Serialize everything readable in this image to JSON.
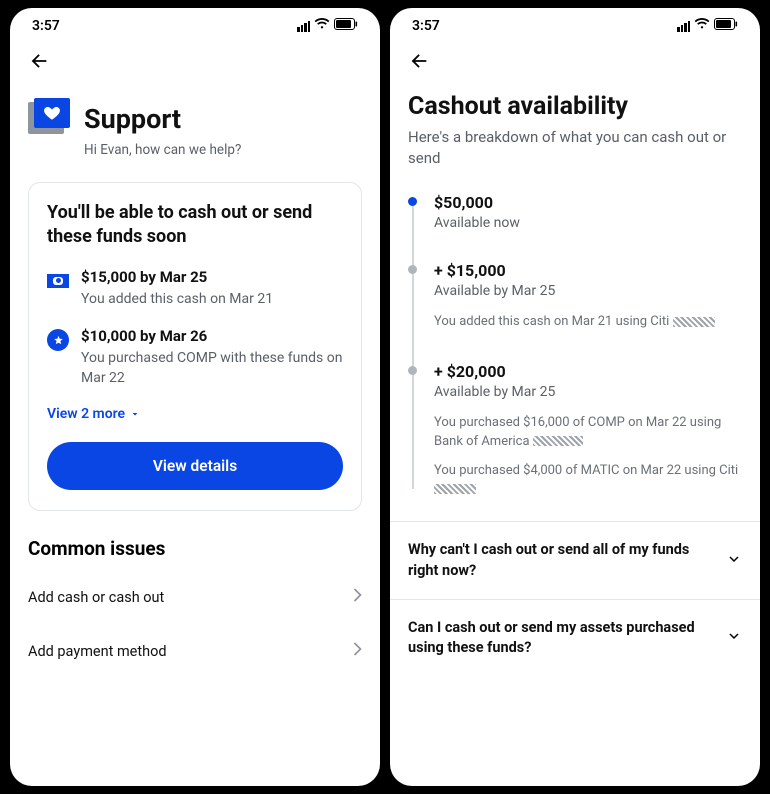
{
  "statusBar": {
    "time": "3:57"
  },
  "screen1": {
    "header": {
      "title": "Support",
      "subtitle": "Hi Evan, how can we help?"
    },
    "card": {
      "title": "You'll be able to cash out or send these funds soon",
      "items": [
        {
          "icon": "cash-icon",
          "amount": "$15,000 by Mar 25",
          "desc": "You added this cash on Mar 21"
        },
        {
          "icon": "star-icon",
          "amount": "$10,000 by Mar 26",
          "desc": "You purchased COMP with these funds on Mar 22"
        }
      ],
      "viewMore": "View 2 more",
      "button": "View details"
    },
    "commonIssues": {
      "title": "Common issues",
      "items": [
        {
          "label": "Add cash or cash out"
        },
        {
          "label": "Add payment method"
        }
      ]
    }
  },
  "screen2": {
    "title": "Cashout availability",
    "subtitle": "Here's a breakdown of what you can cash out or send",
    "timeline": [
      {
        "dot": "blue",
        "amount": "$50,000",
        "avail": "Available now",
        "details": []
      },
      {
        "dot": "gray",
        "amount": "+ $15,000",
        "avail": "Available by Mar 25",
        "details": [
          "You added this cash on Mar 21 using Citi"
        ]
      },
      {
        "dot": "gray",
        "amount": "+ $20,000",
        "avail": "Available by Mar 25",
        "details": [
          "You purchased $16,000 of COMP on Mar 22  using Bank of America",
          "You purchased $4,000 of MATIC on Mar 22 using Citi"
        ]
      }
    ],
    "faq": [
      {
        "q": "Why can't I cash out or send all of my funds right now?"
      },
      {
        "q": "Can I cash out or send my assets purchased using these funds?"
      }
    ]
  }
}
